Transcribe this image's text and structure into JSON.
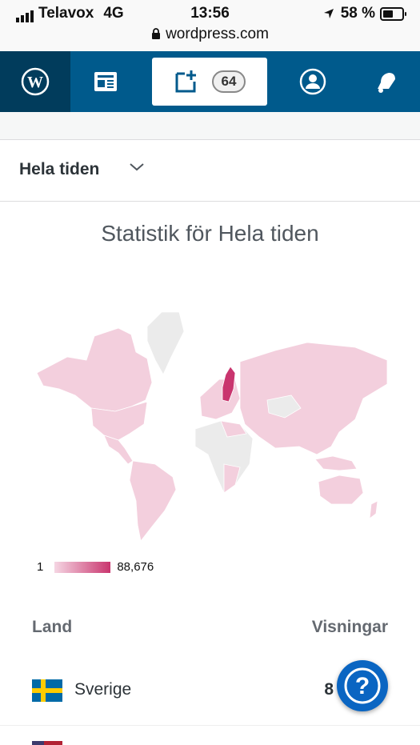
{
  "status_bar": {
    "carrier": "Telavox",
    "network": "4G",
    "time": "13:56",
    "battery": "58 %",
    "url": "wordpress.com",
    "lock_icon": "lock-icon",
    "location_icon": "location-arrow-icon"
  },
  "navbar": {
    "items": [
      {
        "name": "my-sites",
        "icon": "wordpress-logo-icon"
      },
      {
        "name": "reader",
        "icon": "reader-icon"
      },
      {
        "name": "write",
        "icon": "write-post-icon",
        "badge": "64"
      },
      {
        "name": "me",
        "icon": "user-avatar-icon"
      },
      {
        "name": "notifications",
        "icon": "bell-icon"
      }
    ],
    "colors": {
      "bar": "#005a8c",
      "active": "#013c5c"
    }
  },
  "period": {
    "label": "Hela tiden",
    "icon": "chevron-down-icon"
  },
  "stats": {
    "title": "Statistik för Hela tiden",
    "legend_min": "1",
    "legend_max": "88,676",
    "colors": {
      "low": "#f5d6e3",
      "high": "#c9356e",
      "none": "#ebebeb"
    }
  },
  "table": {
    "col_country": "Land",
    "col_views": "Visningar",
    "rows": [
      {
        "country": "Sverige",
        "views": "8",
        "flag": "sweden-flag"
      }
    ]
  },
  "help_button": {
    "icon": "question-mark-icon",
    "label": "?"
  }
}
